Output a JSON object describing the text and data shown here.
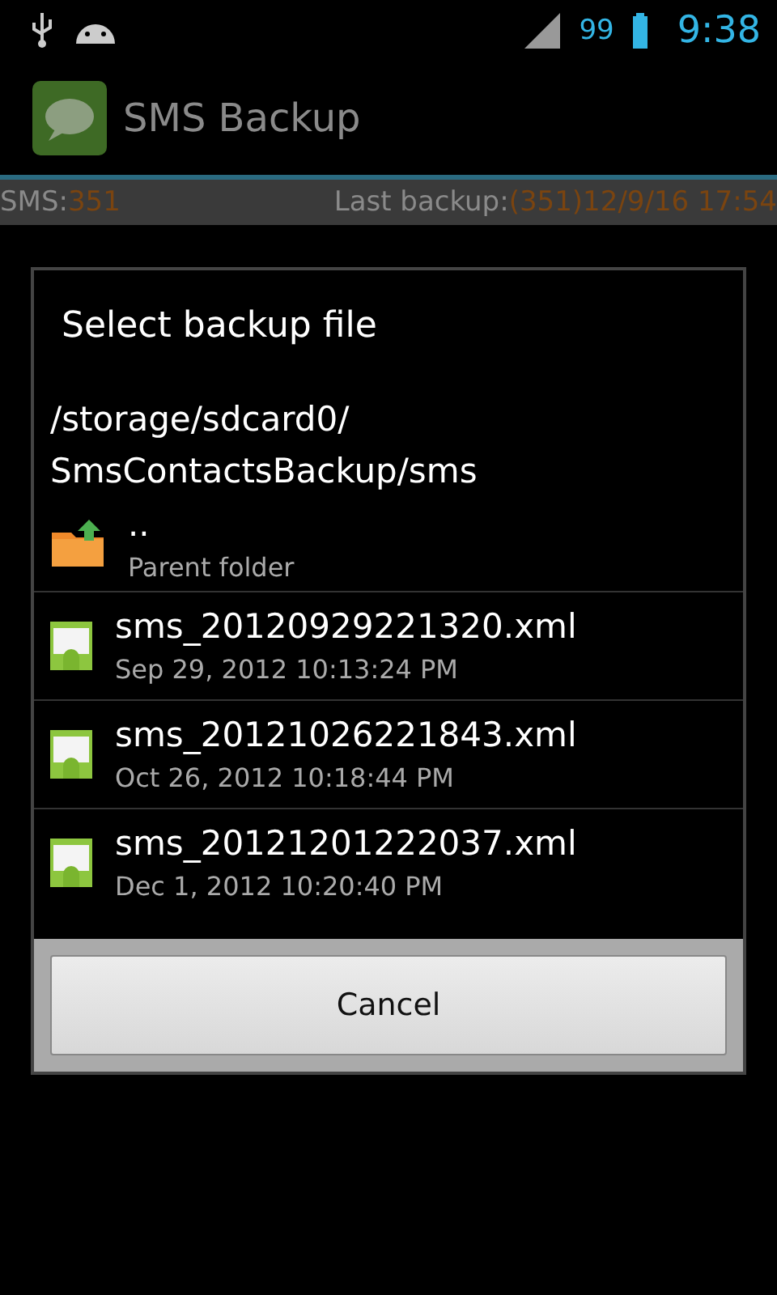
{
  "status_bar": {
    "battery": "99",
    "time": "9:38"
  },
  "app_bar": {
    "title": "SMS Backup"
  },
  "info_bar": {
    "sms_label": "SMS:",
    "sms_count": "351",
    "backup_label": "Last backup:",
    "backup_value": "(351)12/9/16 17:54"
  },
  "dialog": {
    "title": "Select backup file",
    "path": [
      "/storage/sdcard0/",
      "SmsContactsBackup/sms"
    ],
    "items": [
      {
        "kind": "folder",
        "name": "..",
        "detail": "Parent folder"
      },
      {
        "kind": "file",
        "name": "sms_20120929221320.xml",
        "detail": "Sep 29, 2012 10:13:24 PM"
      },
      {
        "kind": "file",
        "name": "sms_20121026221843.xml",
        "detail": "Oct 26, 2012 10:18:44 PM"
      },
      {
        "kind": "file",
        "name": "sms_20121201222037.xml",
        "detail": "Dec 1, 2012 10:20:40 PM"
      }
    ],
    "buttons": [
      "Cancel"
    ]
  }
}
